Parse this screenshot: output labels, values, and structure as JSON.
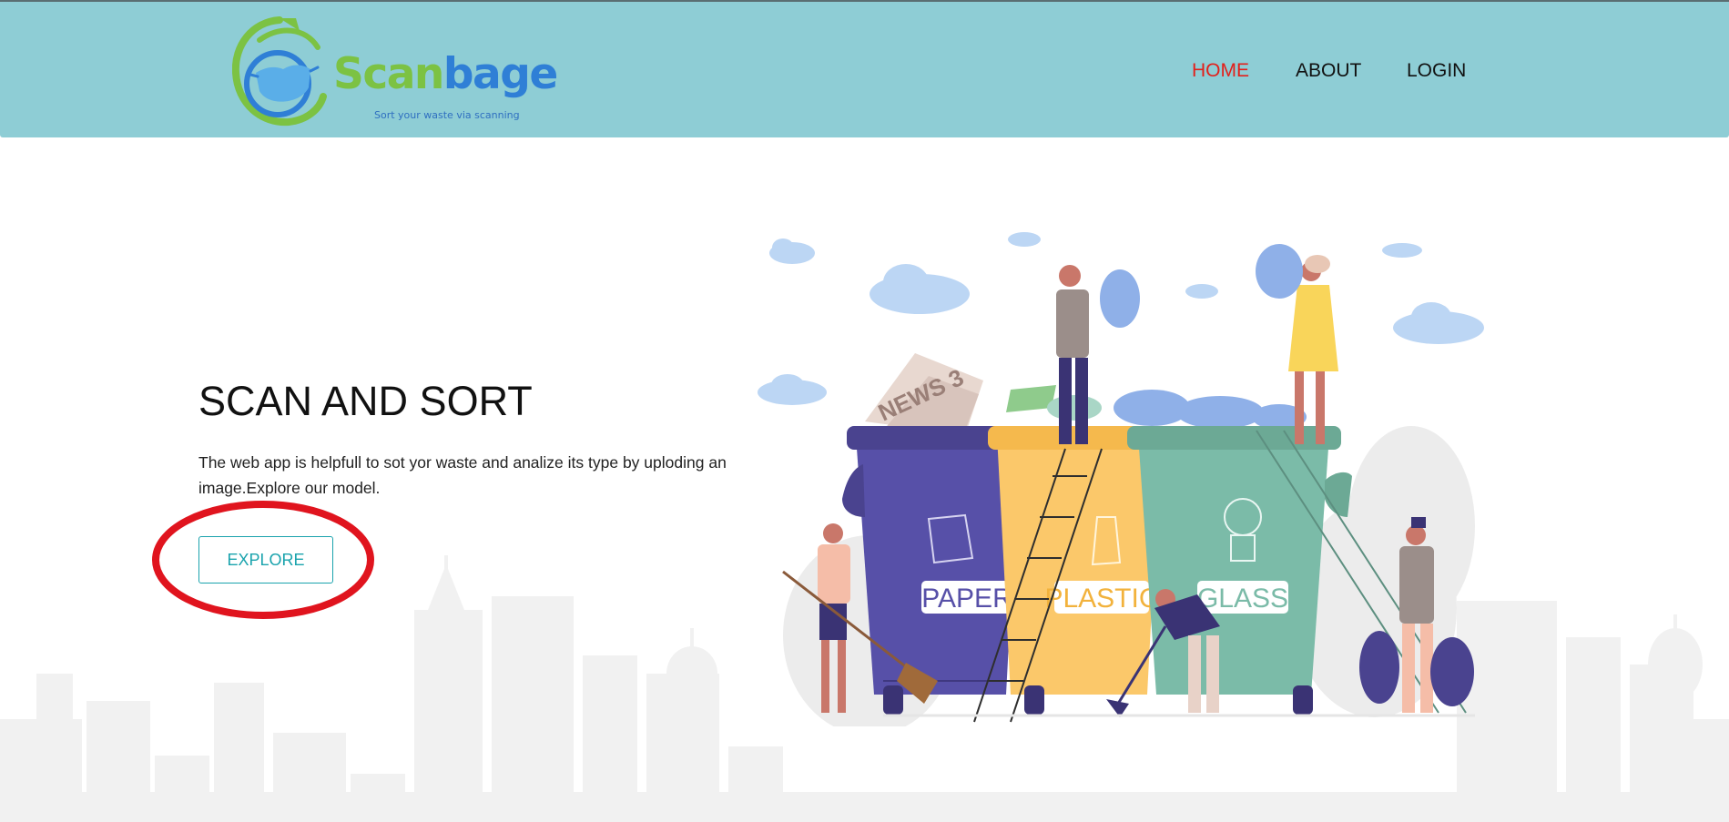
{
  "header": {
    "logo": {
      "word_part1": "Scan",
      "word_part2": "bage",
      "tagline": "Sort your waste via scanning"
    },
    "nav": [
      {
        "label": "HOME",
        "active": true
      },
      {
        "label": "ABOUT",
        "active": false
      },
      {
        "label": "LOGIN",
        "active": false
      }
    ]
  },
  "hero": {
    "title": "SCAN AND SORT",
    "description": "The web app is helpfull to sot yor waste and analize its type by uploding an image.Explore our model.",
    "button_label": "EXPLORE"
  },
  "illustration": {
    "bins": [
      {
        "label": "PAPER",
        "color": "#5750a8"
      },
      {
        "label": "PLASTIC",
        "color": "#fbc86a"
      },
      {
        "label": "GLASS",
        "color": "#7bbba8"
      }
    ],
    "newspaper_text": "NEWS 3"
  },
  "colors": {
    "header_bg": "#8ecdd5",
    "nav_active": "#e3201b",
    "button_accent": "#1aa3ad",
    "annotation": "#e0141e",
    "logo_green": "#7cc243",
    "logo_blue": "#2f7fd6"
  }
}
